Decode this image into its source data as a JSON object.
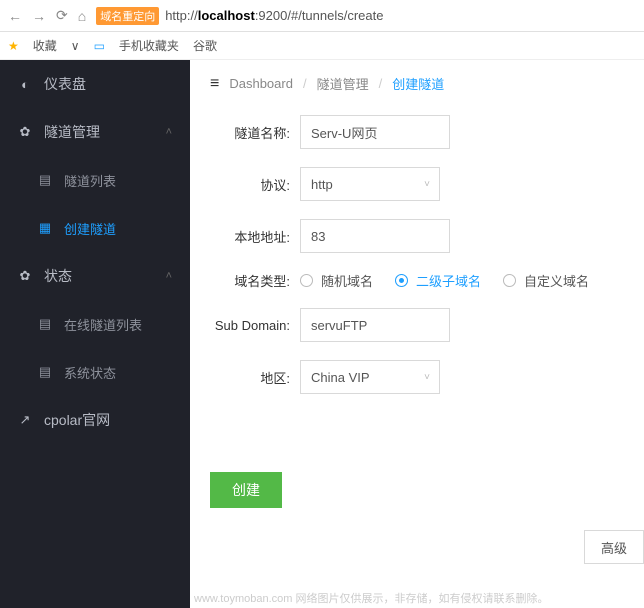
{
  "browser": {
    "redirect_badge": "域名重定向",
    "url_prefix": "http://",
    "url_host": "localhost",
    "url_port": ":9200",
    "url_path": "/#/tunnels/create"
  },
  "bookmarks": {
    "fav": "收藏",
    "mobile": "手机收藏夹",
    "google": "谷歌"
  },
  "sidebar": {
    "dashboard": "仪表盘",
    "tunnel_mgmt": "隧道管理",
    "tunnel_list": "隧道列表",
    "create_tunnel": "创建隧道",
    "status": "状态",
    "online_list": "在线隧道列表",
    "system_status": "系统状态",
    "cpolar": "cpolar官网"
  },
  "breadcrumb": {
    "dashboard": "Dashboard",
    "tunnel_mgmt": "隧道管理",
    "create_tunnel": "创建隧道"
  },
  "form": {
    "name_label": "隧道名称:",
    "name_value": "Serv-U网页",
    "protocol_label": "协议:",
    "protocol_value": "http",
    "local_label": "本地地址:",
    "local_value": "83",
    "domain_type_label": "域名类型:",
    "random_domain": "随机域名",
    "sub_domain_radio": "二级子域名",
    "custom_domain": "自定义域名",
    "subdomain_label": "Sub Domain:",
    "subdomain_value": "servuFTP",
    "region_label": "地区:",
    "region_value": "China VIP",
    "advanced": "高级",
    "create": "创建"
  },
  "footer": "www.toymoban.com  网络图片仅供展示，非存储，如有侵权请联系删除。"
}
